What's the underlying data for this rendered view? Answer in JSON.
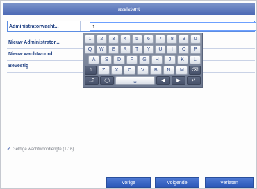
{
  "window": {
    "title": "assistent"
  },
  "fields": [
    {
      "label": "Administratorwacht...",
      "value": "1"
    },
    {
      "label": "Nieuw Administrator...",
      "value": ""
    },
    {
      "label": "Nieuw wachtwoord",
      "value": ""
    },
    {
      "label": "Bevestig",
      "value": ""
    }
  ],
  "keyboard": {
    "row1": [
      "1",
      "2",
      "3",
      "4",
      "5",
      "6",
      "7",
      "8",
      "9",
      "0"
    ],
    "row2": [
      "Q",
      "W",
      "E",
      "R",
      "T",
      "Y",
      "U",
      "I",
      "O",
      "P"
    ],
    "row3": [
      "A",
      "S",
      "D",
      "F",
      "G",
      "H",
      "J",
      "K",
      "L"
    ],
    "row4_shift_icon": "shift-icon",
    "row4": [
      "Z",
      "X",
      "C",
      "V",
      "B",
      "N",
      "M"
    ],
    "row4_backspace_icon": "backspace-icon",
    "row5_symbols": ".,?",
    "row5_globe_icon": "globe-icon",
    "row5_space_icon": "space-icon",
    "row5_left_icon": "arrow-left-icon",
    "row5_right_icon": "arrow-right-icon",
    "row5_enter_icon": "enter-icon"
  },
  "hint": {
    "check_icon": "checkmark-icon",
    "text": "Geldige wachtwoordlengte (1-16)"
  },
  "buttons": {
    "prev": "Vorige",
    "next": "Volgende",
    "exit": "Verlaten"
  },
  "colors": {
    "title_bar": "#4a67b4",
    "button": "#2c58b8",
    "label": "#1e3f82"
  }
}
